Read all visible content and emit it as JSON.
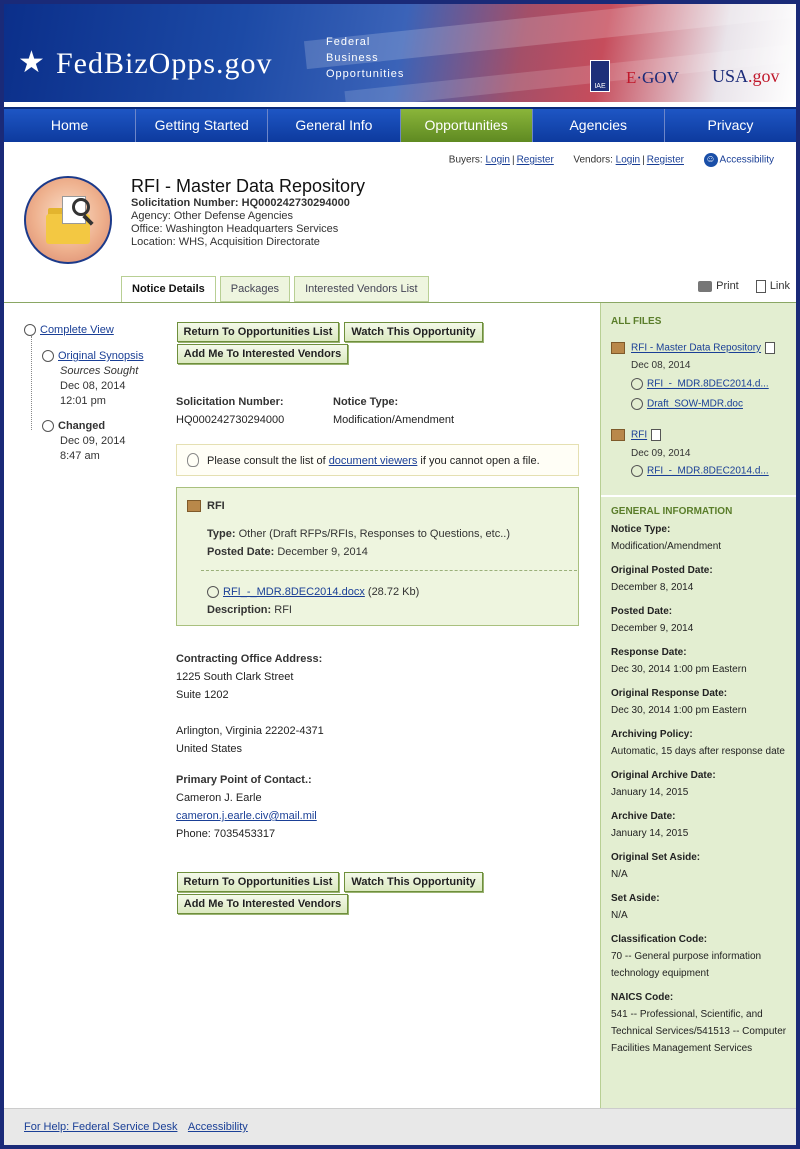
{
  "banner": {
    "logo_star": "★",
    "logo_text": "FedBizOpps.gov",
    "logo_sub_1": "Federal",
    "logo_sub_2": "Business",
    "logo_sub_3": "Opportunities",
    "iae": "IAE",
    "egov_e": "E",
    "egov_rest": "·GOV",
    "usa": "USA",
    "usa_gov": ".gov"
  },
  "nav": [
    "Home",
    "Getting Started",
    "General Info",
    "Opportunities",
    "Agencies",
    "Privacy"
  ],
  "util": {
    "buyers": "Buyers:",
    "vendors": "Vendors:",
    "login": "Login",
    "register": "Register",
    "accessibility": "Accessibility"
  },
  "notice": {
    "title": "RFI - Master Data Repository",
    "sol_label": "Solicitation Number:",
    "sol_value": "HQ000242730294000",
    "agency": "Agency: Other Defense Agencies",
    "office": "Office: Washington Headquarters Services",
    "location": "Location: WHS, Acquisition Directorate"
  },
  "tabs": [
    "Notice Details",
    "Packages",
    "Interested Vendors List"
  ],
  "actions": {
    "print": "Print",
    "link": "Link"
  },
  "timeline": {
    "complete_view": "Complete View",
    "original": "Original Synopsis",
    "original_type": "Sources Sought",
    "original_date": "Dec 08, 2014",
    "original_time": "12:01 pm",
    "changed": "Changed",
    "changed_date": "Dec 09, 2014",
    "changed_time": "8:47 am"
  },
  "buttons": {
    "return": "Return To Opportunities List",
    "watch": "Watch This Opportunity",
    "add": "Add Me To Interested Vendors"
  },
  "details": {
    "sol_label": "Solicitation Number:",
    "sol_value": "HQ000242730294000",
    "type_label": "Notice Type:",
    "type_value": "Modification/Amendment"
  },
  "tip": {
    "pre": "Please consult the list of ",
    "link": "document viewers",
    "post": " if you cannot open a file."
  },
  "rfi": {
    "heading": "RFI",
    "type_label": "Type:",
    "type_value": "Other (Draft RFPs/RFIs, Responses to Questions, etc..)",
    "posted_label": "Posted Date:",
    "posted_value": "December 9, 2014",
    "file_link": "RFI_-_MDR.8DEC2014.docx",
    "file_size": "(28.72 Kb)",
    "desc_label": "Description:",
    "desc_value": "RFI"
  },
  "contact": {
    "office_label": "Contracting Office Address:",
    "addr1": "1225 South Clark Street",
    "addr2": "Suite 1202",
    "addr3": "Arlington, Virginia 22202-4371",
    "addr4": "United States",
    "poc_label": "Primary Point of Contact.:",
    "name": "Cameron J. Earle",
    "email": "cameron.j.earle.civ@mail.mil",
    "phone": "Phone: 7035453317"
  },
  "files": {
    "heading": "ALL FILES",
    "group1_name": "RFI - Master Data Repository",
    "group1_date": "Dec 08, 2014",
    "group1_file1": "RFI_-_MDR.8DEC2014.d...",
    "group1_file2": "Draft_SOW-MDR.doc",
    "group2_name": "RFI",
    "group2_date": "Dec 09, 2014",
    "group2_file1": "RFI_-_MDR.8DEC2014.d..."
  },
  "general": {
    "heading": "GENERAL INFORMATION",
    "notice_type_k": "Notice Type:",
    "notice_type_v": "Modification/Amendment",
    "orig_posted_k": "Original Posted Date:",
    "orig_posted_v": "December 8, 2014",
    "posted_k": "Posted Date:",
    "posted_v": "December 9, 2014",
    "response_k": "Response Date:",
    "response_v": "Dec 30, 2014 1:00 pm Eastern",
    "orig_response_k": "Original Response Date:",
    "orig_response_v": "Dec 30, 2014 1:00 pm Eastern",
    "archiving_k": "Archiving Policy:",
    "archiving_v": "Automatic, 15 days after response date",
    "orig_archive_k": "Original Archive Date:",
    "orig_archive_v": "January 14, 2015",
    "archive_k": "Archive Date:",
    "archive_v": "January 14, 2015",
    "orig_setaside_k": "Original Set Aside:",
    "orig_setaside_v": "N/A",
    "setaside_k": "Set Aside:",
    "setaside_v": "N/A",
    "class_k": "Classification Code:",
    "class_v": "70 -- General purpose information technology equipment",
    "naics_k": "NAICS Code:",
    "naics_v": "541 -- Professional, Scientific, and Technical Services/541513 -- Computer Facilities Management Services"
  },
  "footer": {
    "help": "For Help: Federal Service Desk",
    "accessibility": "Accessibility"
  }
}
